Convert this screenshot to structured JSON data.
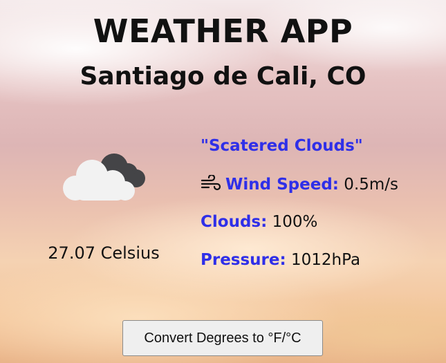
{
  "app": {
    "title": "WEATHER APP",
    "city": "Santiago de Cali, CO"
  },
  "weather": {
    "icon": "scattered-clouds-icon",
    "temperature": "27.07 Celsius",
    "description": "\"Scatered Clouds\"",
    "wind_label": "Wind Speed:",
    "wind_value": " 0.5m/s",
    "wind_icon": "wind-icon",
    "clouds_label": "Clouds:",
    "clouds_value": " 100%",
    "pressure_label": "Pressure:",
    "pressure_value": " 1012hPa"
  },
  "controls": {
    "convert_label": "Convert Degrees to °F/°C"
  },
  "colors": {
    "accent": "#2f2fe8",
    "text": "#111111",
    "button_bg": "#efefef"
  }
}
